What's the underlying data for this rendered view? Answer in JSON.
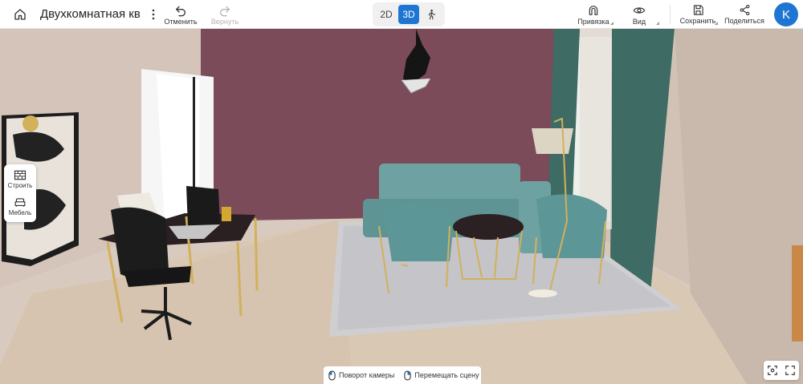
{
  "header": {
    "title": "Двухкомнатная квар",
    "undo_label": "Отменить",
    "redo_label": "Вернуть",
    "view_modes": [
      "2D",
      "3D"
    ],
    "active_view_mode": "3D",
    "snap_label": "Привязка",
    "view_label": "Вид",
    "save_label": "Сохранить",
    "share_label": "Поделиться",
    "avatar_letter": "K"
  },
  "left_panel": {
    "build_label": "Строить",
    "furniture_label": "Мебель"
  },
  "hints": {
    "rotate_label": "Поворот камеры",
    "move_label": "Перемещать сцену"
  },
  "colors": {
    "accent": "#1f76d2",
    "accent_wall": "#7b4b5a",
    "side_wall": "#d3c3b8",
    "floor": "#d9c8b6",
    "sofa": "#6ea2a2",
    "curtain": "#3e6b63"
  },
  "icons": [
    "home-icon",
    "more-vertical-icon",
    "undo-icon",
    "redo-icon",
    "walk-icon",
    "magnet-icon",
    "eye-icon",
    "save-icon",
    "share-icon",
    "wall-build-icon",
    "sofa-icon",
    "mouse-left-icon",
    "mouse-right-icon",
    "fit-view-icon",
    "fullscreen-icon"
  ]
}
